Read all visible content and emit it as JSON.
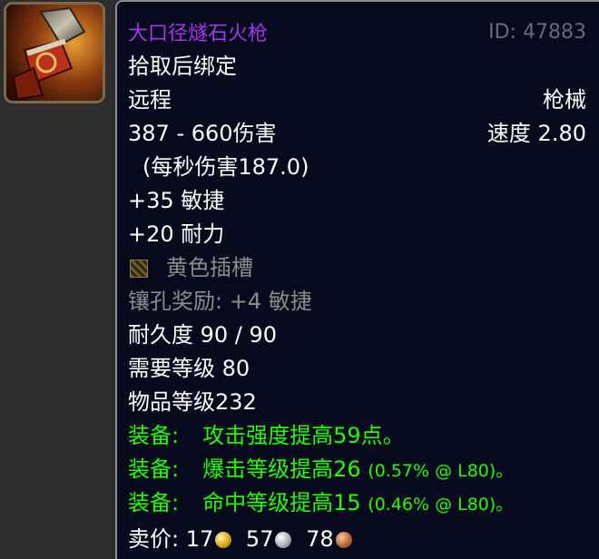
{
  "item": {
    "name": "大口径燧石火枪",
    "id_label": "ID: 47883",
    "binding": "拾取后绑定",
    "slot": "远程",
    "type": "枪械",
    "damage": "387 - 660伤害",
    "speed": "速度 2.80",
    "dps": "(每秒伤害187.0)",
    "stats": [
      "+35 敏捷",
      "+20 耐力"
    ],
    "socket": {
      "label": "黄色插槽",
      "icon": "yellow-socket-icon"
    },
    "socket_bonus": "镶孔奖励: +4 敏捷",
    "durability": "耐久度 90 / 90",
    "required_level": "需要等级 80",
    "item_level": "物品等级232",
    "equip_effects": [
      {
        "prefix": "装备:",
        "text": "攻击强度提高59点。",
        "extra": ""
      },
      {
        "prefix": "装备:",
        "text": "爆击等级提高26",
        "extra": "(0.57% @ L80)。"
      },
      {
        "prefix": "装备:",
        "text": "命中等级提高15",
        "extra": "(0.46% @ L80)。"
      }
    ],
    "sell_price": {
      "label": "卖价:",
      "gold": "17",
      "silver": "57",
      "copper": "78"
    },
    "icon": "flintlock-gun-icon"
  },
  "colors": {
    "epic": "#a335ee",
    "green": "#1eff00",
    "grey": "#8c8c8c",
    "background": "#070a1c"
  }
}
